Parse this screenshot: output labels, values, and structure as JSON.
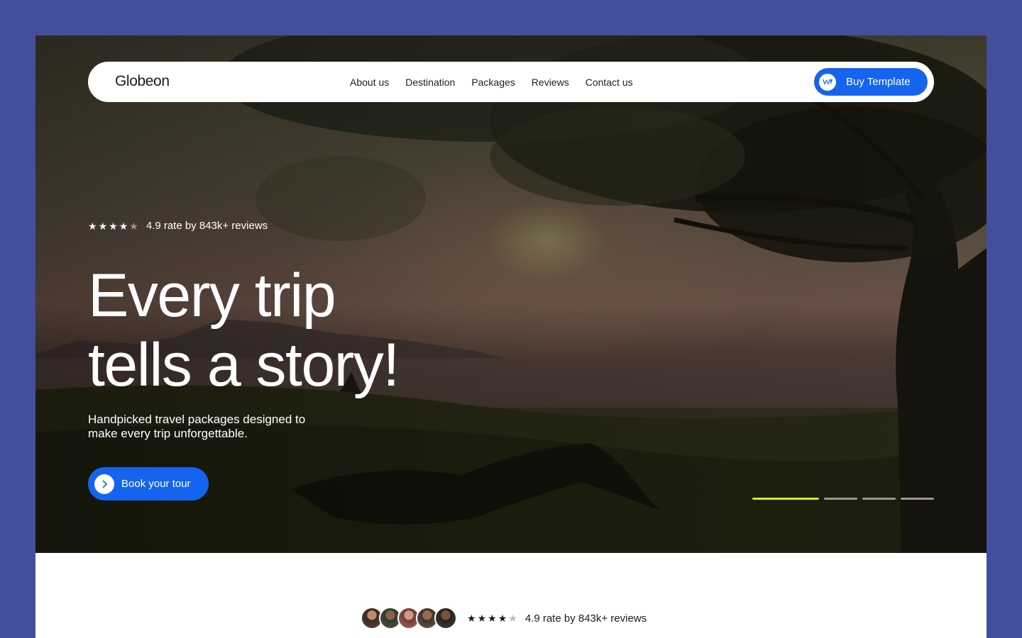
{
  "nav": {
    "logo": "Globeon",
    "links": [
      "About us",
      "Destination",
      "Packages",
      "Reviews",
      "Contact us"
    ],
    "buy_label": "Buy Template",
    "buy_icon": "webflow-icon"
  },
  "hero": {
    "rating_stars": 4,
    "rating_text": "4.9 rate by 843k+ reviews",
    "headline_line1": "Every trip",
    "headline_line2": "tells a story!",
    "subtext": "Handpicked travel packages designed to make every trip unforgettable.",
    "cta_label": "Book your tour",
    "cta_icon": "chevron-right-icon",
    "slides": 4,
    "active_slide": 1
  },
  "social_proof": {
    "avatar_count": 5,
    "rating_stars": 4,
    "rating_text": "4.9 rate by 843k+ reviews"
  },
  "colors": {
    "page_background": "#434f9c",
    "accent_blue": "#1464f0",
    "active_slide": "#c9ef2a"
  }
}
